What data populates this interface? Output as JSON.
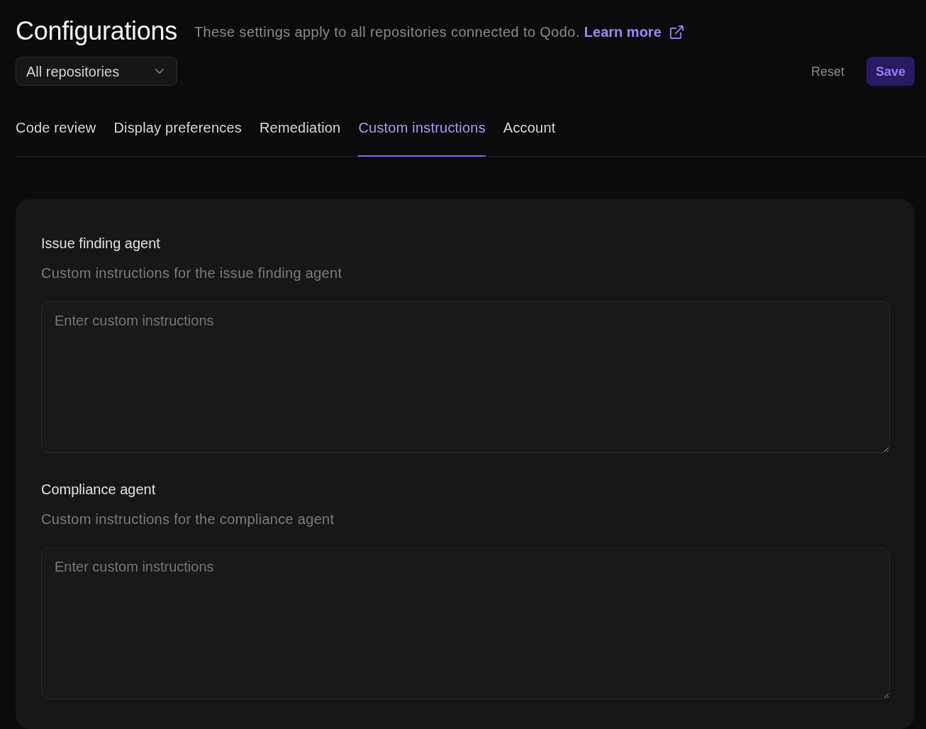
{
  "header": {
    "title": "Configurations",
    "description": "These settings apply to all repositories connected to Qodo.",
    "link": "Learn more"
  },
  "repository_select": {
    "value": "All repositories"
  },
  "actions": [
    {
      "kind": "ghost",
      "label": "Reset"
    },
    {
      "kind": "primary",
      "label": "Save"
    }
  ],
  "tabs": [
    {
      "label": "Code review",
      "selected": false
    },
    {
      "label": "Display preferences",
      "selected": false
    },
    {
      "label": "Remediation",
      "selected": false
    },
    {
      "label": "Custom instructions",
      "selected": true
    },
    {
      "label": "Account",
      "selected": false
    }
  ],
  "sections": [
    {
      "title": "Issue finding agent",
      "description": "Custom instructions for the issue finding agent",
      "placeholder": "Enter custom instructions"
    },
    {
      "title": "Compliance agent",
      "description": "Custom instructions for the compliance agent",
      "placeholder": "Enter custom instructions"
    }
  ]
}
